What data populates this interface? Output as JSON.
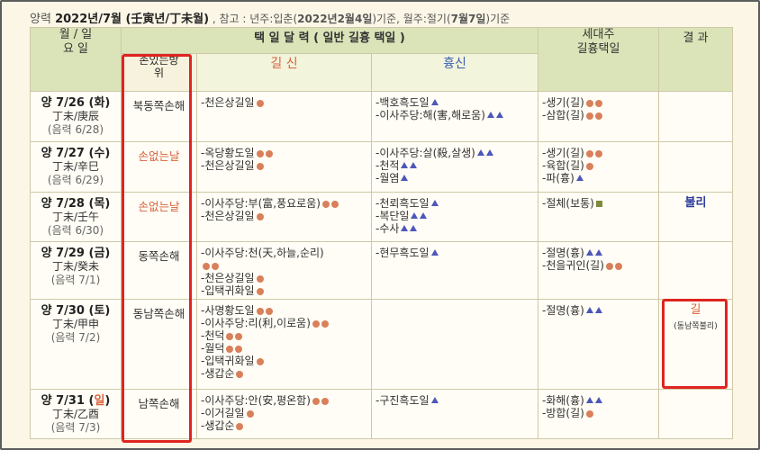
{
  "header": {
    "prefix": "양력 ",
    "title": "2022년/7월",
    "ganji": " (壬寅년/丁未월)",
    "note": " ,  참고 : 년주:입춘(",
    "note_date1": "2022년2월4일",
    "note_mid": ")기준,  월주:절기(",
    "note_date2": "7월7일",
    "note_end": ")기준"
  },
  "table": {
    "col_date": "월 / 일\n요 일",
    "group_title": "택 일 달 력 ( 일반 길흉 택일 )",
    "col_son": "손있는방\n위",
    "col_gilsin": "길 신",
    "col_hyungsin": "흉신",
    "col_sedaeju": "세대주\n길흉택일",
    "col_result": "결 과"
  },
  "legend_colors": {
    "gil": "#d9805a",
    "hyung": "#4d57b8",
    "normal": "#7f8a3a"
  },
  "rows": [
    {
      "date": "양 7/26 (화)",
      "sunday": false,
      "ganji": "丁未/庚辰",
      "lunar": "(음력 6/28)",
      "son": "북동쪽손해",
      "son_red": false,
      "gilsin": [
        {
          "t": "-천은상길일",
          "m": "dot1"
        }
      ],
      "hyungsin": [
        {
          "t": "-백호흑도일",
          "m": "tri1"
        },
        {
          "t": "-이사주당:해(害,해로움)",
          "m": "tri2"
        }
      ],
      "sedaeju": [
        {
          "t": "-생기(길)",
          "m": "dot2"
        },
        {
          "t": "-삼합(길)",
          "m": "dot2"
        }
      ],
      "result": ""
    },
    {
      "date": "양 7/27 (수)",
      "sunday": false,
      "ganji": "丁未/辛巳",
      "lunar": "(음력 6/29)",
      "son": "손없는날",
      "son_red": true,
      "gilsin": [
        {
          "t": "-옥당황도일",
          "m": "dot2"
        },
        {
          "t": "-천은상길일",
          "m": "dot1"
        }
      ],
      "hyungsin": [
        {
          "t": "-이사주당:살(殺,살생)",
          "m": "tri2"
        },
        {
          "t": "-천적",
          "m": "tri2"
        },
        {
          "t": "-월염",
          "m": "tri1"
        }
      ],
      "sedaeju": [
        {
          "t": "-생기(길)",
          "m": "dot2"
        },
        {
          "t": "-육합(길)",
          "m": "dot1"
        },
        {
          "t": "-파(흉)",
          "m": "tri1"
        }
      ],
      "result": ""
    },
    {
      "date": "양 7/28 (목)",
      "sunday": false,
      "ganji": "丁未/壬午",
      "lunar": "(음력 6/30)",
      "son": "손없는날",
      "son_red": true,
      "gilsin": [
        {
          "t": "-이사주당:부(富,풍요로움)",
          "m": "dot2"
        },
        {
          "t": "-천은상길일",
          "m": "dot1"
        }
      ],
      "hyungsin": [
        {
          "t": "-천뢰흑도일",
          "m": "tri1"
        },
        {
          "t": "-복단일",
          "m": "tri2"
        },
        {
          "t": "-수사",
          "m": "tri2"
        }
      ],
      "sedaeju": [
        {
          "t": "-절체(보통)",
          "m": "sq"
        }
      ],
      "result": "불리"
    },
    {
      "date": "양 7/29 (금)",
      "sunday": false,
      "ganji": "丁未/癸未",
      "lunar": "(음력 7/1)",
      "son": "동쪽손해",
      "son_red": false,
      "gilsin": [
        {
          "t": "-이사주당:천(天,하늘,순리)",
          "m": ""
        },
        {
          "t": "",
          "m": "dot2"
        },
        {
          "t": "-천은상길일",
          "m": "dot1"
        },
        {
          "t": "-입택귀화일",
          "m": "dot1"
        }
      ],
      "hyungsin": [
        {
          "t": "-현무흑도일",
          "m": "tri1"
        }
      ],
      "sedaeju": [
        {
          "t": "-절명(흉)",
          "m": "tri2"
        },
        {
          "t": "-천을귀인(길)",
          "m": "dot2"
        }
      ],
      "result": ""
    },
    {
      "date": "양 7/30 (토)",
      "sunday": false,
      "ganji": "丁未/甲申",
      "lunar": "(음력 7/2)",
      "son": "동남쪽손해",
      "son_red": false,
      "gilsin": [
        {
          "t": "-사명황도일",
          "m": "dot2"
        },
        {
          "t": "-이사주당:리(利,이로움)",
          "m": "dot2"
        },
        {
          "t": "-천덕",
          "m": "dot2"
        },
        {
          "t": "-월덕",
          "m": "dot2"
        },
        {
          "t": "-입택귀화일",
          "m": "dot1"
        },
        {
          "t": "-생갑순",
          "m": "dot1"
        }
      ],
      "hyungsin": [],
      "sedaeju": [
        {
          "t": "-절명(흉)",
          "m": "tri2"
        }
      ],
      "result": "길",
      "result_sub": "(동남쪽불리)"
    },
    {
      "date": "양 7/31 (일)",
      "sunday": true,
      "ganji": "丁未/乙酉",
      "lunar": "(음력 7/3)",
      "son": "남쪽손해",
      "son_red": false,
      "gilsin": [
        {
          "t": "-이사주당:안(安,평온함)",
          "m": "dot2"
        },
        {
          "t": "-이거길일",
          "m": "dot1"
        },
        {
          "t": "-생갑순",
          "m": "dot1"
        }
      ],
      "hyungsin": [
        {
          "t": "-구진흑도일",
          "m": "tri1"
        }
      ],
      "sedaeju": [
        {
          "t": "-화해(흉)",
          "m": "tri2"
        },
        {
          "t": "-방합(길)",
          "m": "dot1"
        }
      ],
      "result": ""
    }
  ]
}
